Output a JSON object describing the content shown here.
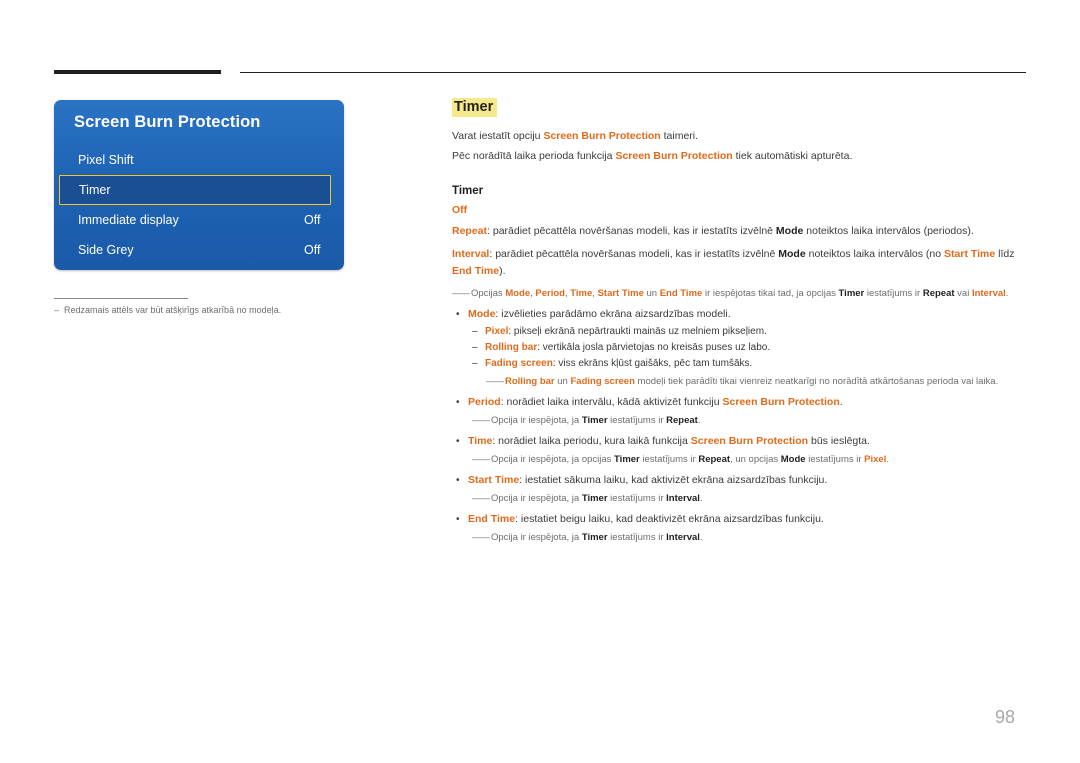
{
  "menu": {
    "title": "Screen Burn Protection",
    "rows": [
      {
        "label": "Pixel Shift",
        "value": ""
      },
      {
        "label": "Timer",
        "value": ""
      },
      {
        "label": "Immediate display",
        "value": "Off"
      },
      {
        "label": "Side Grey",
        "value": "Off"
      }
    ],
    "selected_index": 1
  },
  "footnote": {
    "dash": "–",
    "text": "Redzamais attēls var būt atšķirīgs atkarībā no modeļa."
  },
  "content": {
    "heading": "Timer",
    "intro": [
      {
        "pre": "Varat iestatīt opciju ",
        "bold": "Screen Burn Protection",
        "post": " taimeri."
      },
      {
        "pre": "Pēc norādītā laika perioda funkcija ",
        "bold": "Screen Burn Protection",
        "post": " tiek automātiski apturēta."
      }
    ],
    "sub_heading": "Timer",
    "option_off": "Off",
    "repeat": {
      "term": "Repeat",
      "t1": ": parādiet pēcattēla novēršanas modeli, kas ir iestatīts izvēlnē ",
      "b1": "Mode",
      "t2": " noteiktos laika intervālos (periodos)."
    },
    "interval": {
      "term": "Interval",
      "t1": ": parādiet pēcattēla novēršanas modeli, kas ir iestatīts izvēlnē ",
      "b1": "Mode",
      "t2": " noteiktos laika intervālos (no ",
      "b2": "Start Time",
      "t3": " līdz ",
      "b3": "End Time",
      "t4": ")."
    },
    "note_options": {
      "t1": "Opcijas ",
      "b1": "Mode",
      "t2": ", ",
      "b2": "Period",
      "t3": ", ",
      "b3": "Time",
      "t4": ", ",
      "b4": "Start Time",
      "t5": " un ",
      "b5": "End Time",
      "t6": " ir iespējotas tikai tad, ja opcijas ",
      "b6": "Timer",
      "t7": " iestatījums ir ",
      "b7": "Repeat",
      "t8": " vai ",
      "b8": "Interval",
      "t9": "."
    },
    "mode": {
      "term": "Mode",
      "text": ": izvēlieties parādāmo ekrāna aizsardzības modeli.",
      "items": [
        {
          "term": "Pixel",
          "text": ": pikseļi ekrānā nepārtraukti mainās uz melniem pikseļiem."
        },
        {
          "term": "Rolling bar",
          "text": ": vertikāla josla pārvietojas no kreisās puses uz labo."
        },
        {
          "term": "Fading screen",
          "text": ": viss ekrāns kļūst gaišāks, pēc tam tumšāks."
        }
      ],
      "note": {
        "b1": "Rolling bar",
        "t1": " un ",
        "b2": "Fading screen",
        "t2": " modeļi tiek parādīti tikai vienreiz neatkarīgi no norādītā atkārtošanas perioda vai laika."
      }
    },
    "period": {
      "term": "Period",
      "t1": ": norādiet laika intervālu, kādā aktivizēt funkciju ",
      "b1": "Screen Burn Protection",
      "t2": ".",
      "note": {
        "t1": "Opcija ir iespējota, ja ",
        "b1": "Timer",
        "t2": " iestatījums ir ",
        "b2": "Repeat",
        "t3": "."
      }
    },
    "time": {
      "term": "Time",
      "t1": ": norādiet laika periodu, kura laikā funkcija ",
      "b1": "Screen Burn Protection",
      "t2": " būs ieslēgta.",
      "note": {
        "t1": "Opcija ir iespējota, ja opcijas ",
        "b1": "Timer",
        "t2": " iestatījums ir ",
        "b2": "Repeat",
        "t3": ", un opcijas ",
        "b3": "Mode",
        "t4": " iestatījums ir ",
        "b4": "Pixel",
        "t5": "."
      }
    },
    "start_time": {
      "term": "Start Time",
      "text": ": iestatiet sākuma laiku, kad aktivizēt ekrāna aizsardzības funkciju.",
      "note": {
        "t1": "Opcija ir iespējota, ja ",
        "b1": "Timer",
        "t2": " iestatījums ir ",
        "b2": "Interval",
        "t3": "."
      }
    },
    "end_time": {
      "term": "End Time",
      "text": ": iestatiet beigu laiku, kad deaktivizēt ekrāna aizsardzības funkciju.",
      "note": {
        "t1": "Opcija ir iespējota, ja ",
        "b1": "Timer",
        "t2": " iestatījums ir ",
        "b2": "Interval",
        "t3": "."
      }
    }
  },
  "page_number": "98"
}
